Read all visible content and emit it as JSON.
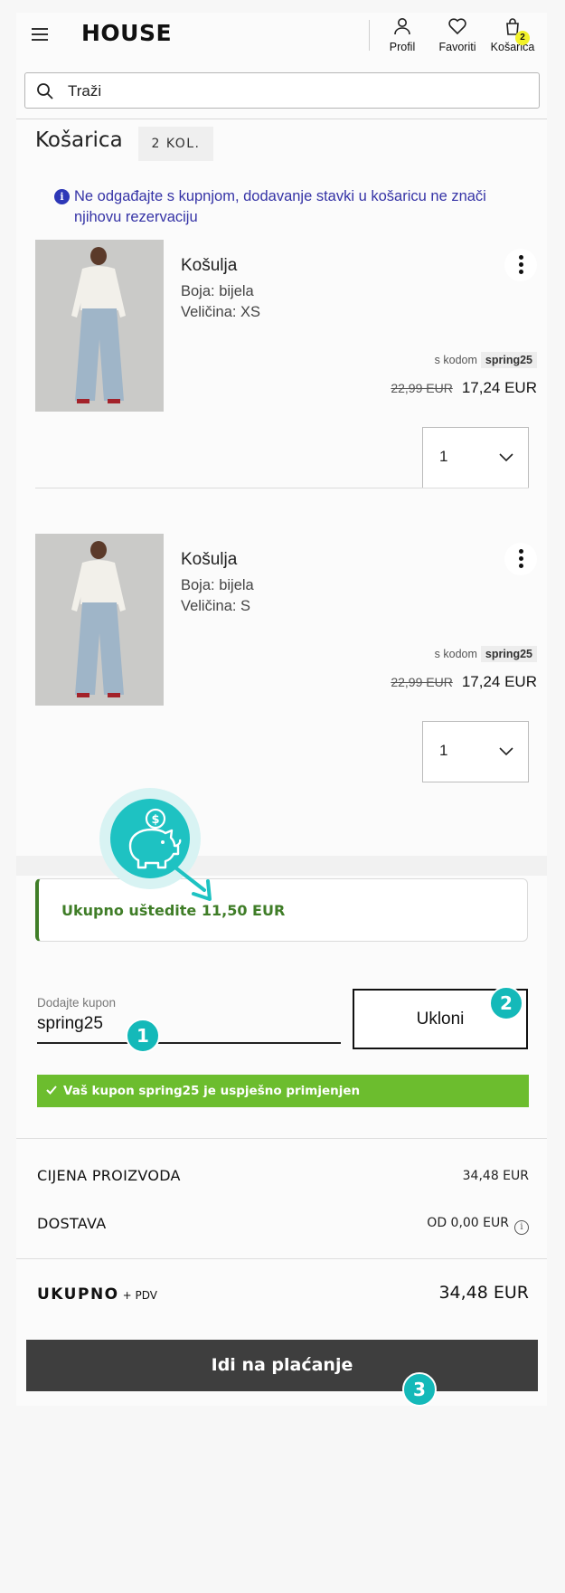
{
  "header": {
    "logo": "HOUSE",
    "profile_label": "Profil",
    "favorites_label": "Favoriti",
    "cart_label": "Košarica",
    "cart_count": "2"
  },
  "search": {
    "placeholder": "Traži"
  },
  "cart": {
    "title": "Košarica",
    "qty_tag": "2 KOL.",
    "info_message": "Ne odgađajte s kupnjom, dodavanje stavki u košaricu ne znači njihovu rezervaciju"
  },
  "items": [
    {
      "name": "Košulja",
      "color": "Boja: bijela",
      "size": "Veličina: XS",
      "code_prefix": "s kodom",
      "code": "spring25",
      "old_price": "22,99 EUR",
      "new_price": "17,24 EUR",
      "quantity": "1"
    },
    {
      "name": "Košulja",
      "color": "Boja: bijela",
      "size": "Veličina: S",
      "code_prefix": "s kodom",
      "code": "spring25",
      "old_price": "22,99 EUR",
      "new_price": "17,24 EUR",
      "quantity": "1"
    }
  ],
  "savings": {
    "text": "Ukupno uštedite 11,50 EUR"
  },
  "coupon": {
    "label": "Dodajte kupon",
    "value": "spring25",
    "remove_label": "Ukloni",
    "success_message": "Vaš kupon spring25 je uspješno primjenjen"
  },
  "summary": {
    "products_label": "CIJENA PROIZVODA",
    "products_value": "34,48 EUR",
    "delivery_label": "DOSTAVA",
    "delivery_value": "OD 0,00 EUR",
    "total_label": "UKUPNO",
    "total_suffix": "+ PDV",
    "total_value": "34,48 EUR"
  },
  "checkout": {
    "label": "Idi na plaćanje"
  },
  "steps": [
    "1",
    "2",
    "3"
  ],
  "colors": {
    "accent_teal": "#14b9b9",
    "success_green": "#6cbd2e",
    "savings_green": "#3f7d27",
    "info_blue": "#3533a6",
    "checkout_bg": "#3e3e3e",
    "badge_yellow": "#f2f22a"
  },
  "icons": [
    "menu-icon",
    "user-icon",
    "heart-icon",
    "bag-icon",
    "search-icon",
    "info-icon",
    "more-vertical-icon",
    "chevron-down-icon",
    "check-icon",
    "piggy-bank-icon"
  ]
}
